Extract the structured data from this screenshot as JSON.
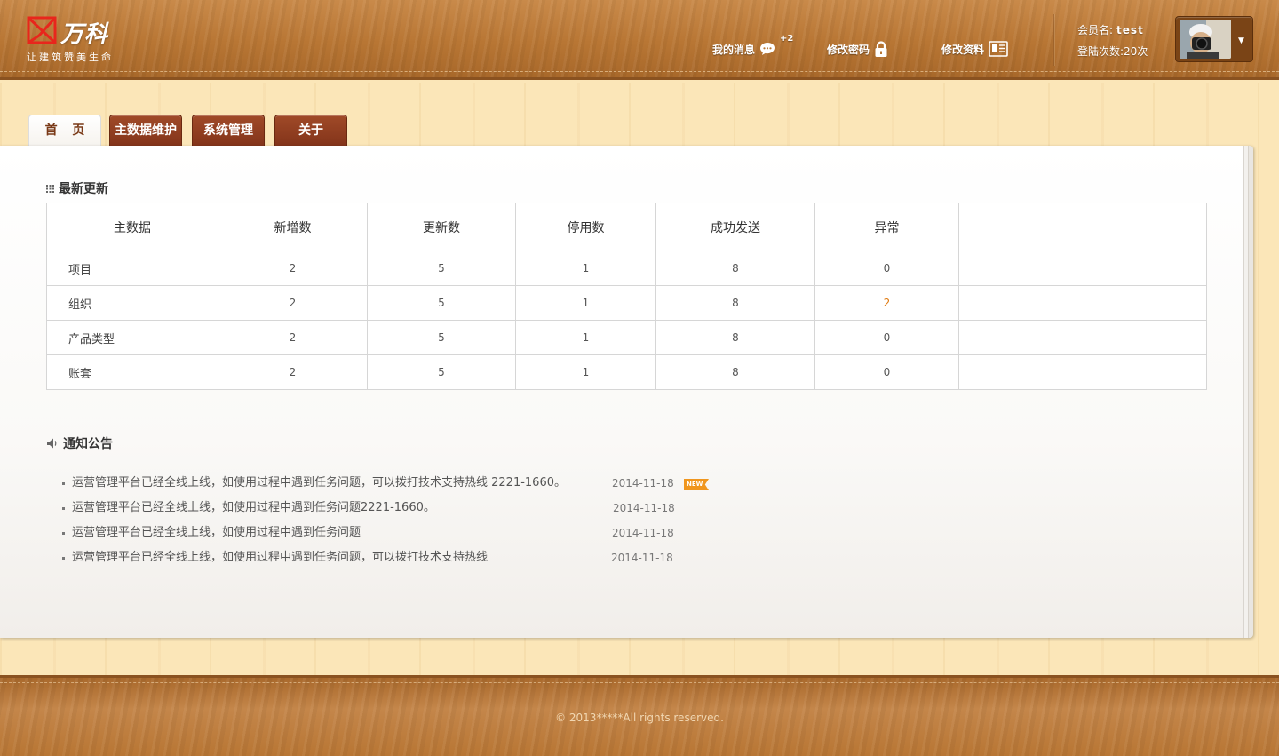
{
  "brand": {
    "name": "万科",
    "slogan": "让建筑赞美生命"
  },
  "header_nav": {
    "messages_label": "我的消息",
    "messages_badge": "+2",
    "change_password_label": "修改密码",
    "edit_profile_label": "修改资料"
  },
  "user": {
    "member_label": "会员名:",
    "member_name": "test",
    "login_label": "登陆次数:",
    "login_count": "20次"
  },
  "tabs": [
    {
      "label": "首 页",
      "active": true
    },
    {
      "label": "主数据维护",
      "active": false
    },
    {
      "label": "系统管理",
      "active": false
    },
    {
      "label": "关于",
      "active": false
    }
  ],
  "updates": {
    "title": "最新更新",
    "columns": [
      "主数据",
      "新增数",
      "更新数",
      "停用数",
      "成功发送",
      "异常"
    ],
    "rows": [
      [
        "项目",
        "2",
        "5",
        "1",
        "8",
        "0"
      ],
      [
        "组织",
        "2",
        "5",
        "1",
        "8",
        "2"
      ],
      [
        "产品类型",
        "2",
        "5",
        "1",
        "8",
        "0"
      ],
      [
        "账套",
        "2",
        "5",
        "1",
        "8",
        "0"
      ]
    ]
  },
  "notices": {
    "title": "通知公告",
    "new_badge": "NEW",
    "items": [
      {
        "text": "运营管理平台已经全线上线，如使用过程中遇到任务问题，可以拨打技术支持热线  2221-1660。",
        "date": "2014-11-18",
        "is_new": true
      },
      {
        "text": "运营管理平台已经全线上线，如使用过程中遇到任务问题2221-1660。",
        "date": "2014-11-18",
        "is_new": false
      },
      {
        "text": "运营管理平台已经全线上线，如使用过程中遇到任务问题",
        "date": "2014-11-18",
        "is_new": false
      },
      {
        "text": "运营管理平台已经全线上线，如使用过程中遇到任务问题，可以拨打技术支持热线",
        "date": "2014-11-18",
        "is_new": false
      }
    ]
  },
  "footer": {
    "copyright": "© 2013*****All rights reserved."
  },
  "colors": {
    "header_wood": "#b87634",
    "tab_brown": "#8a3a1c",
    "page_bg": "#fbe6b8",
    "warning_orange": "#e07a10",
    "new_badge": "#f0961e"
  }
}
